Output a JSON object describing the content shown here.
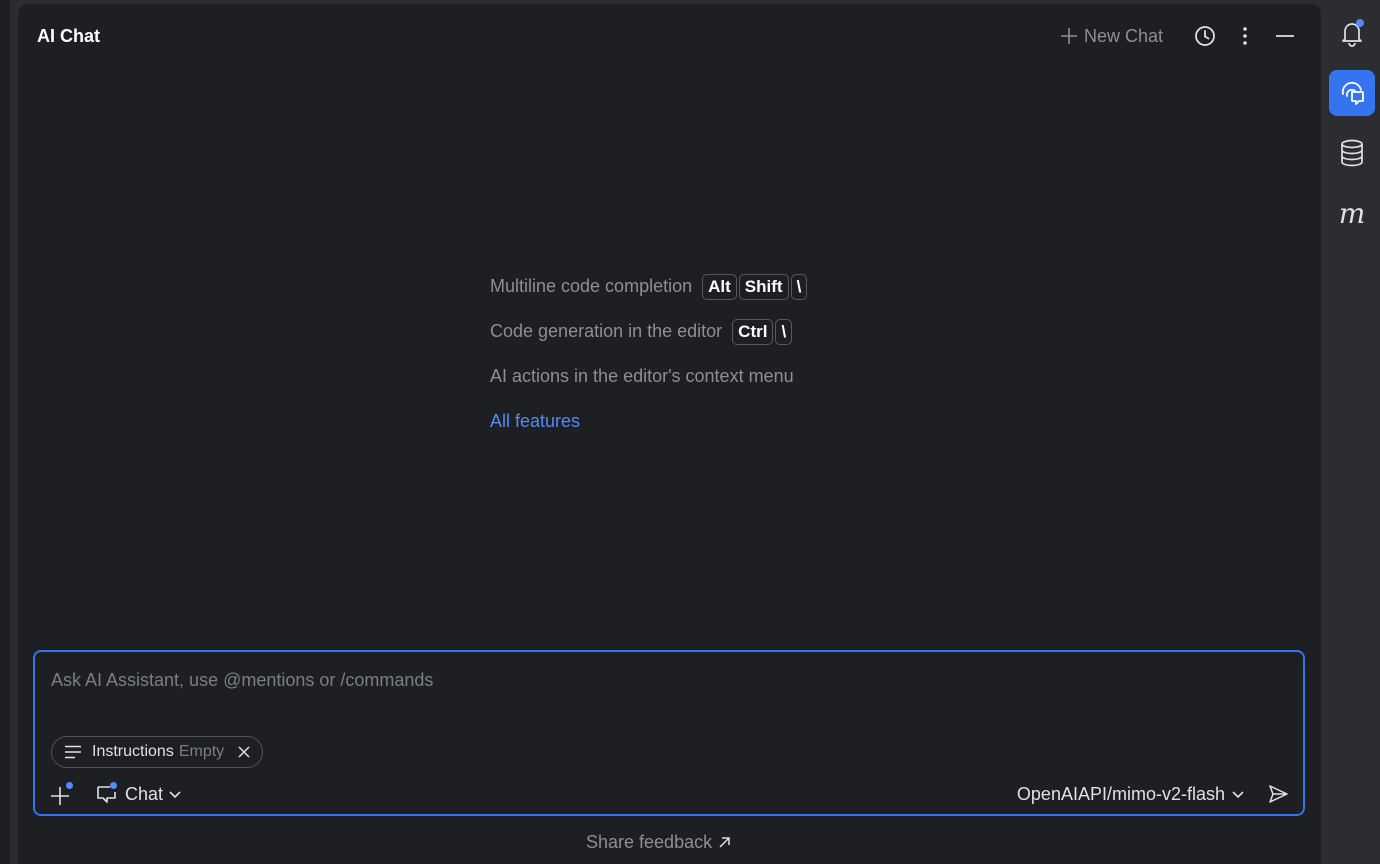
{
  "panel": {
    "title": "AI Chat",
    "toolbar": {
      "new_chat_label": "New Chat",
      "new_chat_icon": "plus-icon",
      "history_icon": "clock-icon",
      "more_icon": "more-vertical-icon",
      "minimize_icon": "minimize-icon"
    }
  },
  "tips": {
    "items": [
      {
        "label": "Multiline code completion",
        "keys": [
          "Alt",
          "Shift",
          "\\"
        ]
      },
      {
        "label": "Code generation in the editor",
        "keys": [
          "Ctrl",
          "\\"
        ]
      },
      {
        "label": "AI actions in the editor's context menu",
        "keys": []
      }
    ],
    "all_features_label": "All features"
  },
  "input": {
    "placeholder": "Ask AI Assistant, use @mentions or /commands",
    "instructions_chip": {
      "label": "Instructions",
      "sub": "Empty"
    },
    "mode_label": "Chat",
    "model_label": "OpenAIAPI/mimo-v2-flash"
  },
  "footer": {
    "feedback_label": "Share feedback",
    "feedback_symbol": "↗"
  },
  "right_rail": {
    "items": [
      "bell-icon",
      "ai-chat-icon",
      "database-icon",
      "m-icon"
    ],
    "m_glyph": "m"
  },
  "colors": {
    "accent": "#3574f0",
    "link": "#548af7",
    "background": "#1e1f22",
    "muted_text": "#8c8f96"
  }
}
